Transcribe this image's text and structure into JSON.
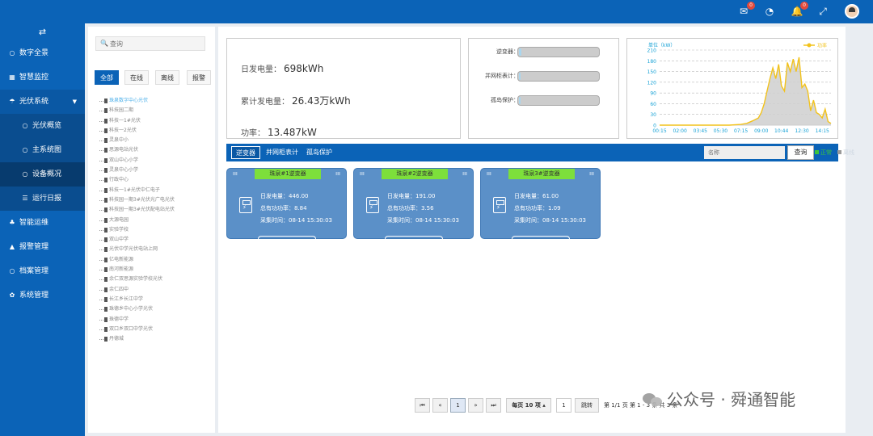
{
  "topbar": {
    "icons": [
      {
        "name": "mail-icon",
        "glyph": "✉",
        "badge": "0"
      },
      {
        "name": "dashboard-icon",
        "glyph": "◔",
        "badge": ""
      },
      {
        "name": "bell-icon",
        "glyph": "🔔",
        "badge": "0"
      },
      {
        "name": "fullscreen-icon",
        "glyph": "⤢",
        "badge": ""
      }
    ]
  },
  "sidebar": {
    "toggle_glyph": "⇄",
    "items": [
      {
        "icon": "○",
        "label": "数字全景"
      },
      {
        "icon": "▦",
        "label": "智慧监控"
      },
      {
        "icon": "☂",
        "label": "光伏系统"
      },
      {
        "icon": "○",
        "label": "光伏概览"
      },
      {
        "icon": "○",
        "label": "主系统图"
      },
      {
        "icon": "○",
        "label": "设备概况"
      },
      {
        "icon": "☰",
        "label": "运行日报"
      },
      {
        "icon": "♣",
        "label": "智能运维"
      },
      {
        "icon": "▲",
        "label": "报警管理"
      },
      {
        "icon": "○",
        "label": "档案管理"
      },
      {
        "icon": "✿",
        "label": "系统管理"
      }
    ]
  },
  "tree": {
    "search_placeholder": "查询",
    "filters": [
      "全部",
      "在线",
      "离线",
      "报警"
    ],
    "nodes": [
      "珠泉数字中心光伏",
      "科技园二期",
      "科技一1#光伏",
      "科技一2光伏",
      "灵泉中小",
      "思源电站光伏",
      "双山中心小学",
      "灵泉中心小学",
      "行政中心",
      "科技一1#光伏中仁电子",
      "科技园一期3#光伏光广电光伏",
      "科技园一期3#光伏配电站光伏",
      "大源电园",
      "实验学校",
      "双山中学",
      "光伏中学光伏电站上网",
      "亿电新能源",
      "南河新能源",
      "余仁双思源实验学校光伏",
      "余仁四中",
      "长江乡长江中学",
      "珠德乡中心小学光伏",
      "珠德中学",
      "双口乡双口中学光伏",
      "丹德城"
    ]
  },
  "summary": {
    "daily_label": "日发电量：",
    "daily_value": "698kWh",
    "total_label": "累计发电量：",
    "total_value": "26.43万kWh",
    "power_label": "功率：",
    "power_value": "13.487kW"
  },
  "status_bars": [
    {
      "label": "逆变器：",
      "fraction": 0.03
    },
    {
      "label": "并网柜表计：",
      "fraction": 0.02
    },
    {
      "label": "孤岛保护：",
      "fraction": 0.02
    }
  ],
  "chart_data": {
    "type": "area",
    "ylabel": "单位（kW）",
    "legend": [
      "功率"
    ],
    "legend_position": "top-right",
    "yticks": [
      0,
      30,
      60,
      90,
      120,
      150,
      180,
      210
    ],
    "ylim": [
      0,
      210
    ],
    "xticks": [
      "00:15",
      "02:00",
      "03:45",
      "05:30",
      "07:15",
      "09:00",
      "10:44",
      "12:30",
      "14:15"
    ],
    "x": [
      "00:15",
      "01:00",
      "02:00",
      "03:00",
      "03:45",
      "04:30",
      "05:30",
      "06:15",
      "07:15",
      "07:45",
      "08:15",
      "08:45",
      "09:00",
      "09:15",
      "09:30",
      "09:45",
      "10:00",
      "10:15",
      "10:30",
      "10:44",
      "11:00",
      "11:15",
      "11:30",
      "11:45",
      "12:00",
      "12:15",
      "12:30",
      "12:45",
      "13:00",
      "13:15",
      "13:30",
      "13:45",
      "14:00",
      "14:15",
      "14:30",
      "14:45",
      "15:00"
    ],
    "y": [
      0,
      0,
      0,
      0,
      0,
      0,
      0,
      0,
      2,
      5,
      12,
      20,
      35,
      60,
      95,
      130,
      160,
      130,
      170,
      110,
      95,
      175,
      150,
      185,
      150,
      190,
      105,
      115,
      95,
      40,
      70,
      35,
      30,
      20,
      45,
      10,
      5
    ],
    "grid": "horizontal-dashed",
    "color": "#f2c21b"
  },
  "tabs": [
    "逆变器",
    "并网柜表计",
    "孤岛保护"
  ],
  "tab_search_placeholder": "名称",
  "query_label": "查询",
  "legend": {
    "normal": "正常",
    "offline": "离线",
    "normal_color": "#3cc43c",
    "offline_color": "#999999"
  },
  "inverters": [
    {
      "title": "珠泉#1逆变器",
      "daily": "日发电量：446.00",
      "active": "总有功功率：8.84",
      "time": "采集时间：08-14 15:30:03"
    },
    {
      "title": "珠泉#2逆变器",
      "daily": "日发电量：191.00",
      "active": "总有功功率：3.56",
      "time": "采集时间：08-14 15:30:03"
    },
    {
      "title": "珠泉3#逆变器",
      "daily": "日发电量：61.00",
      "active": "总有功功率：1.09",
      "time": "采集时间：08-14 15:30:03"
    }
  ],
  "pager": {
    "first": "⏮",
    "prev": "«",
    "page": "1",
    "next": "»",
    "last": "⏭",
    "per_page": "每页 10 项 ▴",
    "jump_value": "1",
    "jump_label": "跳转",
    "info": "第 1/1 页  第 1 - 3 条  共 3 条"
  },
  "watermark": "公众号 · 舜通智能"
}
